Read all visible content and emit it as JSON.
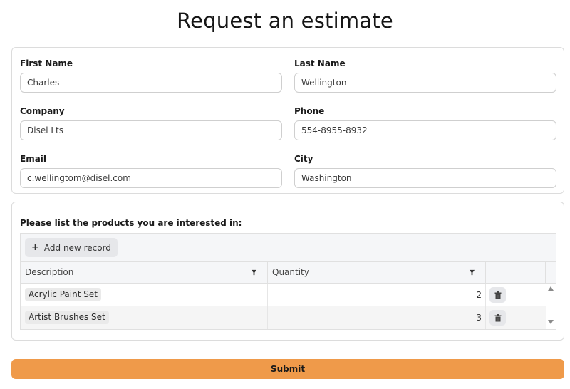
{
  "page": {
    "title": "Request an estimate"
  },
  "form": {
    "first_name": {
      "label": "First Name",
      "value": "Charles"
    },
    "last_name": {
      "label": "Last Name",
      "value": "Wellington"
    },
    "company": {
      "label": "Company",
      "value": "Disel Lts"
    },
    "phone": {
      "label": "Phone",
      "value": "554-8955-8932"
    },
    "email": {
      "label": "Email",
      "value": "c.wellingtom@disel.com"
    },
    "city": {
      "label": "City",
      "value": "Washington"
    }
  },
  "products": {
    "caption": "Please list the products you are interested in:",
    "add_label": "Add new record",
    "columns": [
      "Description",
      "Quantity"
    ],
    "rows": [
      {
        "description": "Acrylic Paint Set",
        "quantity": "2"
      },
      {
        "description": "Artist Brushes Set",
        "quantity": "3"
      }
    ]
  },
  "submit_label": "Submit",
  "colors": {
    "accent": "#ef9a4a",
    "header_bg": "#f5f6f8"
  },
  "icons": {
    "add": "plus-icon",
    "filter": "filter-icon",
    "delete": "trash-icon"
  }
}
